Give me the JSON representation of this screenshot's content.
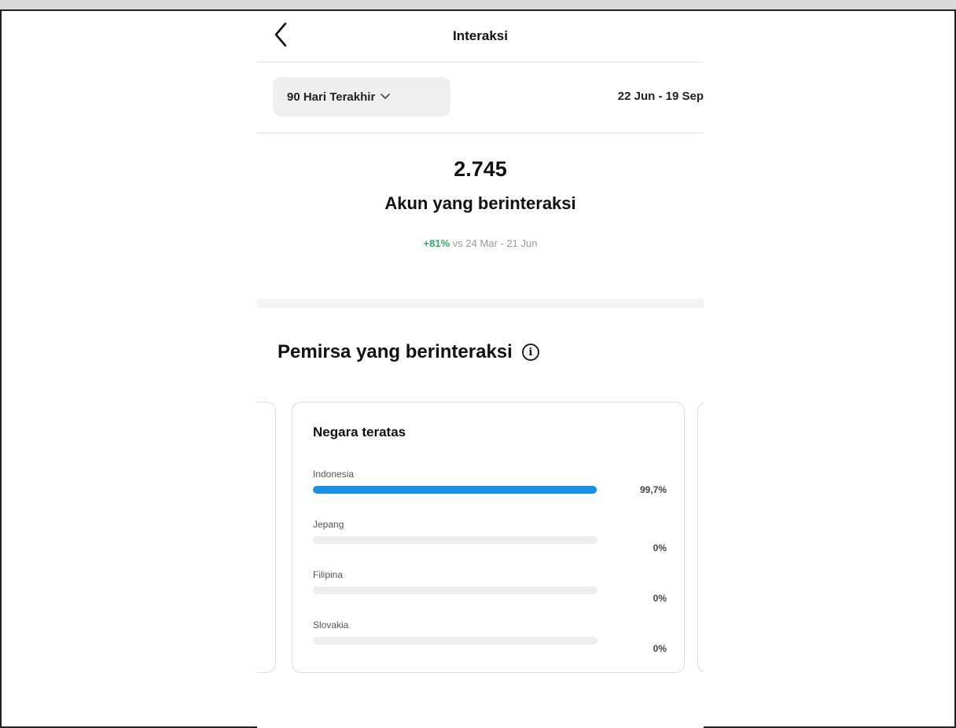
{
  "header": {
    "title": "Interaksi",
    "back_icon": "chevron-left-icon"
  },
  "filters": {
    "range_label": "90 Hari Terakhir",
    "range_icon": "chevron-down-icon",
    "date_range": "22 Jun - 19 Sep"
  },
  "stat": {
    "value": "2.745",
    "label": "Akun yang berinteraksi",
    "change": "+81%",
    "compare_text": "vs 24 Mar - 21 Jun",
    "change_color": "#3aa76d"
  },
  "audience": {
    "title": "Pemirsa yang berinteraksi",
    "info_icon": "info-icon",
    "card": {
      "title": "Negara teratas",
      "bar_color": "#1b8fe6",
      "rows": [
        {
          "label": "Indonesia",
          "pct": "99,7%",
          "fill": 99.7
        },
        {
          "label": "Jepang",
          "pct": "0%",
          "fill": 0
        },
        {
          "label": "Filipina",
          "pct": "0%",
          "fill": 0
        },
        {
          "label": "Slovakia",
          "pct": "0%",
          "fill": 0
        }
      ]
    }
  }
}
